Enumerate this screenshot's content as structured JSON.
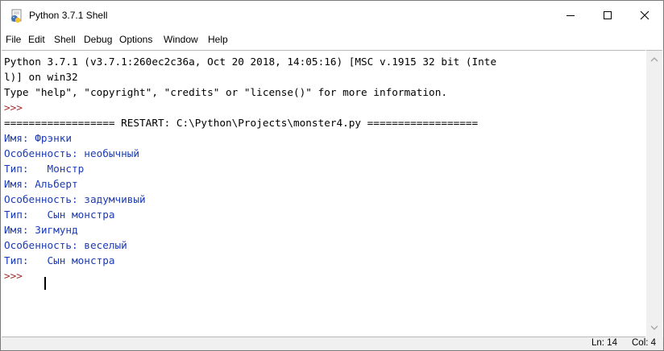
{
  "window": {
    "title": "Python 3.7.1 Shell",
    "icon": "python-idle-icon",
    "controls": {
      "minimize": "minimize-icon",
      "maximize": "maximize-icon",
      "close": "close-icon"
    }
  },
  "menu": {
    "items": [
      "File",
      "Edit",
      "Shell",
      "Debug",
      "Options",
      "Window",
      "Help"
    ]
  },
  "shell": {
    "lines": [
      {
        "text": "Python 3.7.1 (v3.7.1:260ec2c36a, Oct 20 2018, 14:05:16) [MSC v.1915 32 bit (Inte",
        "kind": "banner"
      },
      {
        "text": "l)] on win32",
        "kind": "banner"
      },
      {
        "text": "Type \"help\", \"copyright\", \"credits\" or \"license()\" for more information.",
        "kind": "banner"
      },
      {
        "text": ">>> ",
        "kind": "prompt"
      },
      {
        "text": "================== RESTART: C:\\Python\\Projects\\monster4.py ==================",
        "kind": "banner"
      },
      {
        "text": "Имя: Фрэнки",
        "kind": "output"
      },
      {
        "text": "Особенность: необычный",
        "kind": "output"
      },
      {
        "text": "Тип:   Монстр",
        "kind": "output"
      },
      {
        "text": "Имя: Альберт",
        "kind": "output"
      },
      {
        "text": "Особенность: задумчивый",
        "kind": "output"
      },
      {
        "text": "Тип:   Сын монстра",
        "kind": "output"
      },
      {
        "text": "Имя: Зигмунд",
        "kind": "output"
      },
      {
        "text": "Особенность: веселый",
        "kind": "output"
      },
      {
        "text": "Тип:   Сын монстра",
        "kind": "output"
      },
      {
        "text": ">>> ",
        "kind": "prompt"
      }
    ]
  },
  "status": {
    "line": "Ln: 14",
    "col": "Col: 4"
  },
  "colors": {
    "prompt": "#a52828",
    "output": "#1b3bb5",
    "text": "#000000"
  }
}
